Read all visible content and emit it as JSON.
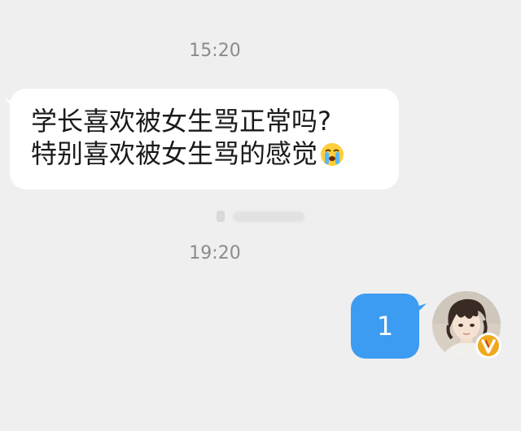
{
  "chat": {
    "timestamps": [
      "15:20",
      "19:20"
    ],
    "incoming_message": {
      "line1": "学长喜欢被女生骂正常吗?",
      "line2": "特别喜欢被女生骂的感觉",
      "emoji": "crying-face-icon"
    },
    "outgoing_message": {
      "text": "1"
    }
  },
  "colors": {
    "background": "#efefef",
    "incoming_bubble": "#ffffff",
    "outgoing_bubble": "#3c9cf2",
    "timestamp_text": "#8b8b8b",
    "badge": "#f0a81c"
  },
  "icons": {
    "avatar": "avatar-image",
    "badge": "verified-v-badge-icon"
  }
}
